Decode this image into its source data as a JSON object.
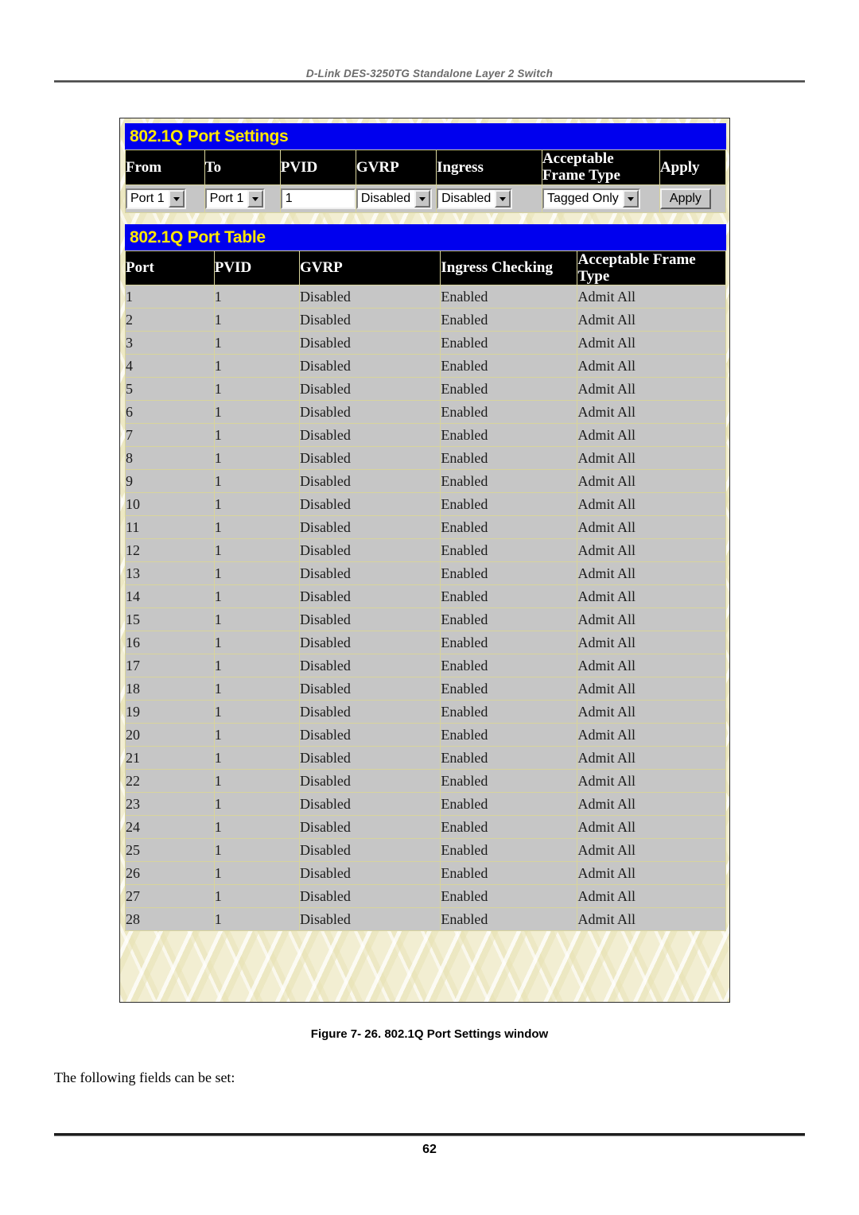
{
  "document": {
    "running_header": "D-Link DES-3250TG Standalone Layer 2 Switch",
    "figure_caption": "Figure 7- 26.  802.1Q Port Settings window",
    "body_text": "The following fields can be set:",
    "page_number": "62"
  },
  "colors": {
    "titlebar_background": "#0000EE",
    "titlebar_text": "#FFE800",
    "header_cell_background": "#000000",
    "header_cell_text": "#FFFFFF",
    "data_cell_background": "#C6C6C6",
    "window_background": "#F2EED2",
    "grid_line": "#D8D49C"
  },
  "port_settings_panel": {
    "title": "802.1Q Port Settings",
    "columns": [
      "From",
      "To",
      "PVID",
      "GVRP",
      "Ingress",
      "Acceptable Frame Type",
      "Apply"
    ],
    "form": {
      "from": {
        "type": "select",
        "value": "Port 1",
        "icon": "chevron-down-icon"
      },
      "to": {
        "type": "select",
        "value": "Port 1",
        "icon": "chevron-down-icon"
      },
      "pvid": {
        "type": "text",
        "value": "1",
        "placeholder": ""
      },
      "gvrp": {
        "type": "select",
        "value": "Disabled",
        "icon": "chevron-down-icon"
      },
      "ingress": {
        "type": "select",
        "value": "Disabled",
        "icon": "chevron-down-icon"
      },
      "acceptable_frame_type": {
        "type": "select",
        "value": "Tagged Only",
        "icon": "chevron-down-icon"
      },
      "apply": {
        "type": "button",
        "label": "Apply"
      }
    }
  },
  "port_table_panel": {
    "title": "802.1Q Port Table",
    "columns": [
      "Port",
      "PVID",
      "GVRP",
      "Ingress Checking",
      "Acceptable Frame Type"
    ],
    "rows": [
      [
        "1",
        "1",
        "Disabled",
        "Enabled",
        "Admit All"
      ],
      [
        "2",
        "1",
        "Disabled",
        "Enabled",
        "Admit All"
      ],
      [
        "3",
        "1",
        "Disabled",
        "Enabled",
        "Admit All"
      ],
      [
        "4",
        "1",
        "Disabled",
        "Enabled",
        "Admit All"
      ],
      [
        "5",
        "1",
        "Disabled",
        "Enabled",
        "Admit All"
      ],
      [
        "6",
        "1",
        "Disabled",
        "Enabled",
        "Admit All"
      ],
      [
        "7",
        "1",
        "Disabled",
        "Enabled",
        "Admit All"
      ],
      [
        "8",
        "1",
        "Disabled",
        "Enabled",
        "Admit All"
      ],
      [
        "9",
        "1",
        "Disabled",
        "Enabled",
        "Admit All"
      ],
      [
        "10",
        "1",
        "Disabled",
        "Enabled",
        "Admit All"
      ],
      [
        "11",
        "1",
        "Disabled",
        "Enabled",
        "Admit All"
      ],
      [
        "12",
        "1",
        "Disabled",
        "Enabled",
        "Admit All"
      ],
      [
        "13",
        "1",
        "Disabled",
        "Enabled",
        "Admit All"
      ],
      [
        "14",
        "1",
        "Disabled",
        "Enabled",
        "Admit All"
      ],
      [
        "15",
        "1",
        "Disabled",
        "Enabled",
        "Admit All"
      ],
      [
        "16",
        "1",
        "Disabled",
        "Enabled",
        "Admit All"
      ],
      [
        "17",
        "1",
        "Disabled",
        "Enabled",
        "Admit All"
      ],
      [
        "18",
        "1",
        "Disabled",
        "Enabled",
        "Admit All"
      ],
      [
        "19",
        "1",
        "Disabled",
        "Enabled",
        "Admit All"
      ],
      [
        "20",
        "1",
        "Disabled",
        "Enabled",
        "Admit All"
      ],
      [
        "21",
        "1",
        "Disabled",
        "Enabled",
        "Admit All"
      ],
      [
        "22",
        "1",
        "Disabled",
        "Enabled",
        "Admit All"
      ],
      [
        "23",
        "1",
        "Disabled",
        "Enabled",
        "Admit All"
      ],
      [
        "24",
        "1",
        "Disabled",
        "Enabled",
        "Admit All"
      ],
      [
        "25",
        "1",
        "Disabled",
        "Enabled",
        "Admit All"
      ],
      [
        "26",
        "1",
        "Disabled",
        "Enabled",
        "Admit All"
      ],
      [
        "27",
        "1",
        "Disabled",
        "Enabled",
        "Admit All"
      ],
      [
        "28",
        "1",
        "Disabled",
        "Enabled",
        "Admit All"
      ]
    ]
  }
}
